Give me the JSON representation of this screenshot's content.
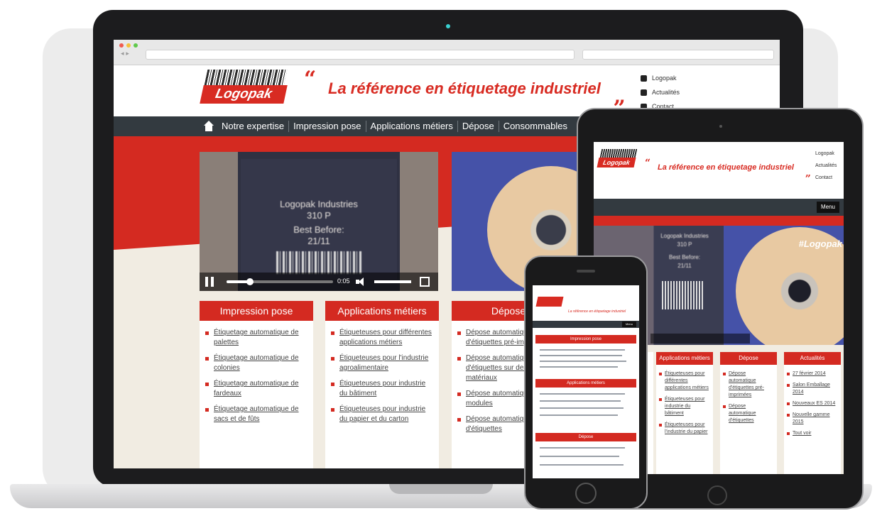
{
  "site": {
    "logo_text": "Logopak",
    "tagline": "La référence en étiquetage industriel",
    "quote_open": "“",
    "quote_close": "„",
    "top_links": [
      {
        "label": "Logopak",
        "icon": "person-icon"
      },
      {
        "label": "Actualités",
        "icon": "speaker-icon"
      },
      {
        "label": "Contact",
        "icon": "chat-icon"
      }
    ],
    "nav": [
      {
        "label": "Notre expertise"
      },
      {
        "label": "Impression pose"
      },
      {
        "label": "Applications métiers"
      },
      {
        "label": "Dépose"
      },
      {
        "label": "Consommables"
      }
    ]
  },
  "video": {
    "label_lines": [
      "Logopak Industries",
      "310 P",
      "Best Before:",
      "21/11"
    ],
    "time": "0:05",
    "progress": 0.22
  },
  "columns": [
    {
      "title": "Impression pose",
      "items": [
        "Étiquetage automatique de palettes",
        "Étiquetage automatique de colonies",
        "Étiquetage automatique de fardeaux",
        "Étiquetage automatique de sacs et de fûts"
      ]
    },
    {
      "title": "Applications métiers",
      "items": [
        "Étiqueteuses pour différentes applications métiers",
        "Étiqueteuses pour l'industrie agroalimentaire",
        "Étiqueteuses pour industrie du bâtiment",
        "Étiqueteuses pour industrie du papier et du carton"
      ]
    },
    {
      "title": "Dépose",
      "items": [
        "Dépose automatique d'étiquettes pré-imprimées",
        "Dépose automatique d'étiquettes sur des matériaux",
        "Dépose automatique de modules",
        "Dépose automatique d'étiquettes"
      ]
    }
  ],
  "tablet": {
    "menu_label": "Menu",
    "brand_overlay": "#Logopak",
    "columns": [
      {
        "title": "Applications métiers",
        "items": [
          "Étiqueteuses pour différentes applications métiers",
          "Étiqueteuses pour industrie du bâtiment",
          "Étiqueteuses pour l'industrie du papier"
        ]
      },
      {
        "title": "Dépose",
        "items": [
          "Dépose automatique d'étiquettes pré-imprimées",
          "Dépose automatique d'étiquettes"
        ]
      },
      {
        "title": "Actualités",
        "items": [
          "27 février 2014",
          "Salon Emballage 2014",
          "Nouveaux ES 2014",
          "Nouvelle gamme 2015"
        ]
      }
    ],
    "more_link": "Tout voir"
  },
  "phone": {
    "menu_label": "Menu",
    "sections": [
      "Impression pose",
      "Applications métiers",
      "Dépose"
    ]
  },
  "colors": {
    "brand_red": "#d42a21",
    "nav_dark": "#333a40",
    "page_bg": "#f1ece2"
  }
}
